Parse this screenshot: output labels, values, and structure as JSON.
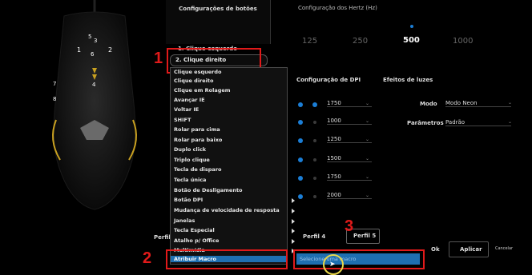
{
  "buttons_panel": {
    "title": "Configurações de botões",
    "item1": "1. Clique esquerdo",
    "item2": "2. Clique direito"
  },
  "hertz": {
    "title": "Configuração dos Hertz (Hz)",
    "options": [
      "125",
      "250",
      "500",
      "1000"
    ],
    "selected": "500"
  },
  "dropdown": {
    "items": [
      "Clique esquerdo",
      "Clique direito",
      "Clique em Rolagem",
      "Avançar IE",
      "Voltar IE",
      "SHIFT",
      "Rolar para cima",
      "Rolar para baixo",
      "Duplo click",
      "Triplo clique",
      "Tecla de disparo",
      "Tecla única",
      "Botão de Desligamento",
      "Botão DPI",
      "Mudança de velocidade de resposta",
      "Janelas",
      "Tecla Especial",
      "Atalho p/ Office",
      "Multimídia",
      "Atribuir Macro"
    ],
    "highlighted": "Atribuir Macro"
  },
  "dpi": {
    "title": "Configuração de DPI",
    "values": [
      "1750",
      "1000",
      "1250",
      "1500",
      "1750",
      "2000"
    ]
  },
  "lights": {
    "title": "Efeitos de luzes",
    "mode_label": "Modo",
    "mode_value": "Modo Neon",
    "params_label": "Parâmetros",
    "params_value": "Padrão"
  },
  "profiles": {
    "left_label": "Perfil",
    "profile4": "Perfil 4",
    "profile5": "Perfil 5"
  },
  "macro_input": {
    "placeholder": "Selecione uma macro"
  },
  "actions": {
    "ok": "Ok",
    "apply": "Aplicar",
    "cancel": "Cancelar"
  },
  "annotations": {
    "n1": "1",
    "n2": "2",
    "n3": "3"
  },
  "mouse_numbers": {
    "n1": "1",
    "n2": "2",
    "n3": "3",
    "n4": "4",
    "n5": "5",
    "n6": "6",
    "n7": "7",
    "n8": "8"
  },
  "colors": {
    "accent": "#1b7ed6",
    "highlight": "#1e6fb0",
    "annotation_red": "#e01a1a"
  }
}
